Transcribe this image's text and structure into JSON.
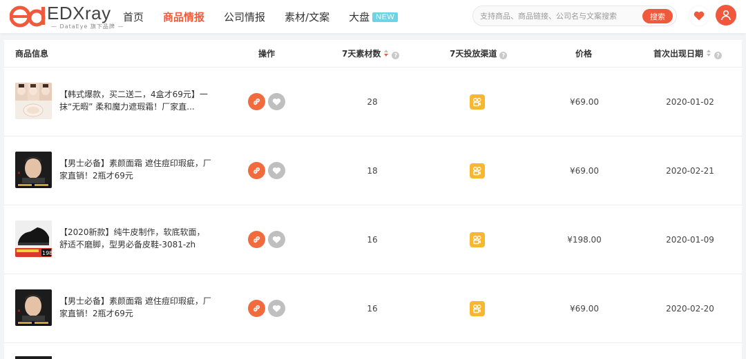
{
  "brand": {
    "logo_text": "EDXray",
    "tagline": "— DataEye 旗下品牌 —",
    "accent": "#f05a3c"
  },
  "nav": {
    "items": [
      {
        "label": "首页",
        "active": false
      },
      {
        "label": "商品情报",
        "active": true
      },
      {
        "label": "公司情报",
        "active": false
      },
      {
        "label": "素材/文案",
        "active": false
      },
      {
        "label": "大盘",
        "active": false,
        "badge": "NEW"
      }
    ]
  },
  "search": {
    "placeholder": "支持商品、商品链接、公司名与文案搜索",
    "button": "搜索"
  },
  "header_icons": {
    "favorites": "heart-icon",
    "user": "user-icon"
  },
  "table": {
    "columns": {
      "product": "商品信息",
      "actions": "操作",
      "materials": "7天素材数",
      "channels": "7天投放渠道",
      "price": "价格",
      "first_seen": "首次出现日期"
    },
    "rows": [
      {
        "title": "【韩式爆款，买二送二，4盒才69元】一抹“无暇” 柔和魔力遮瑕霜！厂家直...",
        "thumb": "cosmetics-faces",
        "materials": "28",
        "channel_icon": "kuaishou-icon",
        "price": "¥69.00",
        "first_seen": "2020-01-02"
      },
      {
        "title": "【男士必备】素颜面霜 遮住痘印瑕疵，厂家直销！2瓶才69元",
        "thumb": "man-portrait",
        "materials": "18",
        "channel_icon": "kuaishou-icon",
        "price": "¥69.00",
        "first_seen": "2020-02-21"
      },
      {
        "title": "【2020新款】纯牛皮制作，软底软面，舒适不磨脚，型男必备皮鞋-3081-zh",
        "thumb": "leather-shoe",
        "materials": "16",
        "channel_icon": "kuaishou-icon",
        "price": "¥198.00",
        "first_seen": "2020-01-09"
      },
      {
        "title": "【男士必备】素颜面霜 遮住痘印瑕疵，厂家直销！2瓶才69元",
        "thumb": "man-portrait",
        "materials": "16",
        "channel_icon": "kuaishou-icon",
        "price": "¥69.00",
        "first_seen": "2020-02-20"
      }
    ]
  }
}
